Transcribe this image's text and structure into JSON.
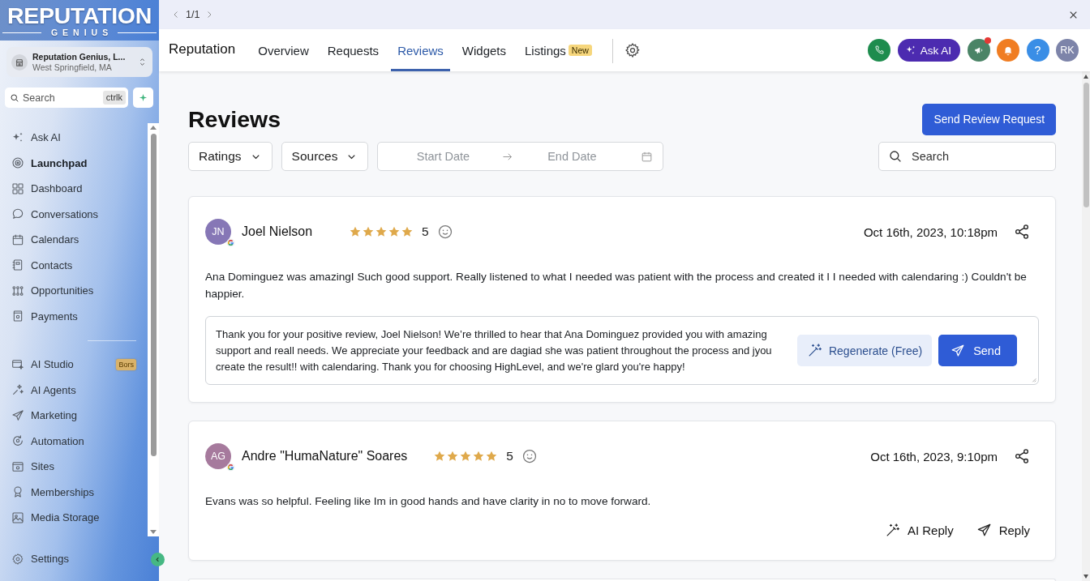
{
  "sidebar": {
    "logo": {
      "wordmark": "REPUTATION",
      "tagline": "GENIUS"
    },
    "account": {
      "name": "Reputation Genius, L...",
      "location": "West Springfield, MA"
    },
    "search": {
      "placeholder": "Search",
      "shortcut": "ctrlk"
    },
    "nav_sections": [
      {
        "items": [
          {
            "label": "Ask AI",
            "selected": false
          },
          {
            "label": "Launchpad",
            "selected": true
          },
          {
            "label": "Dashboard",
            "selected": false
          },
          {
            "label": "Conversations",
            "selected": false
          },
          {
            "label": "Calendars",
            "selected": false
          },
          {
            "label": "Contacts",
            "selected": false
          },
          {
            "label": "Opportunities",
            "selected": false
          },
          {
            "label": "Payments",
            "selected": false
          }
        ]
      },
      {
        "items": [
          {
            "label": "AI Studio",
            "selected": false,
            "badge": "Bors"
          },
          {
            "label": "AI Agents",
            "selected": false
          },
          {
            "label": "Marketing",
            "selected": false
          },
          {
            "label": "Automation",
            "selected": false
          },
          {
            "label": "Sites",
            "selected": false
          },
          {
            "label": "Memberships",
            "selected": false
          },
          {
            "label": "Media Storage",
            "selected": false
          }
        ]
      }
    ],
    "settings": {
      "label": "Settings",
      "selected": false
    }
  },
  "top_strip": {
    "pager": "1/1"
  },
  "nav_bar": {
    "title": "Reputation",
    "tabs": [
      {
        "label": "Overview",
        "selected": false
      },
      {
        "label": "Requests",
        "selected": false
      },
      {
        "label": "Reviews",
        "selected": true
      },
      {
        "label": "Widgets",
        "selected": false
      },
      {
        "label": "Listings",
        "selected": false,
        "badge": "New"
      }
    ],
    "ask_ai": "Ask AI",
    "announcements_unread": true,
    "help": "?",
    "avatar": "RK"
  },
  "page": {
    "title": "Reviews",
    "primary_button": "Send Review Request",
    "filters": [
      "Ratings",
      "Sources"
    ],
    "date_range": {
      "start_placeholder": "Start Date",
      "end_placeholder": "End Date"
    },
    "search": {
      "placeholder": "Search"
    }
  },
  "reviews": [
    {
      "kind": "draft",
      "initials": "JN",
      "color": "#8677b6",
      "name": "Joel Nielson",
      "stars": 5,
      "rating": "5",
      "date": "Oct 16th, 2023, 10:18pm",
      "text": "Ana Dominguez was amazingI Such good support. Really listened to what I needed was patient with the process and created it I I needed with calendaring :) Couldn't be happier.",
      "reply": {
        "value": "Thank you for your positive review, Joel Nielson! We’re thrilled to hear that Ana Dominguez provided you with amazing support and reall needs. We appreciate your feedback and are dagiad she was patient throughout the process and jyou create the result!! with calendaring. Thank you for choosing HighLevel, and we're glard you're happy!",
        "regenerate_label": "Regenerate (Free)",
        "send_label": "Send"
      }
    },
    {
      "kind": "plain",
      "initials": "AG",
      "color": "#a67a9d",
      "name": "Andre \"HumaNature\" Soares",
      "stars": 5,
      "rating": "5",
      "date": "Oct 16th, 2023, 9:10pm",
      "text": "Evans was so helpful. Feeling like Im in good hands and have clarity in no to move forward.",
      "actions": [
        "AI Reply",
        "Reply"
      ]
    }
  ]
}
